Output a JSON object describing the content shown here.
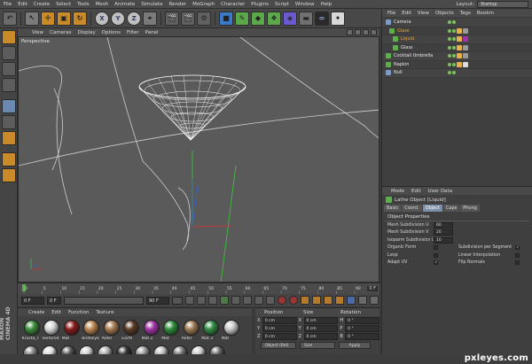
{
  "menubar": {
    "items": [
      "File",
      "Edit",
      "Create",
      "Select",
      "Tools",
      "Mesh",
      "Animate",
      "Simulate",
      "Render",
      "MoGraph",
      "Character",
      "Plugins",
      "Script",
      "Window",
      "Help"
    ],
    "layout_label": "Layout:",
    "layout_value": "Startup"
  },
  "viewport": {
    "menu": [
      "View",
      "Cameras",
      "Display",
      "Options",
      "Filter",
      "Panel"
    ],
    "label": "Perspective"
  },
  "timeline": {
    "ticks": [
      "0",
      "5",
      "10",
      "15",
      "20",
      "25",
      "30",
      "35",
      "40",
      "45",
      "50",
      "55",
      "60",
      "65",
      "70",
      "75",
      "80",
      "85",
      "90"
    ],
    "end_label": "0 F",
    "start_field": "0 F",
    "current_field": "0 F",
    "end_field": "90 F"
  },
  "materials": {
    "menu": [
      "Create",
      "Edit",
      "Function",
      "Texture"
    ],
    "items": [
      {
        "name": "Krusta_T",
        "color": "#3c8a3a"
      },
      {
        "name": "Textured",
        "color": "#d8d8d8"
      },
      {
        "name": "Mat",
        "color": "#8a1a1a"
      },
      {
        "name": "Birdseye",
        "color": "#b98550"
      },
      {
        "name": "Alder",
        "color": "#a57a4e"
      },
      {
        "name": "Earth",
        "color": "#5c3b26"
      },
      {
        "name": "Mat.2",
        "color": "#a034a7"
      },
      {
        "name": "Mat",
        "color": "#2e8a3a"
      },
      {
        "name": "Alder",
        "color": "#9b7a52"
      },
      {
        "name": "Mat.3",
        "color": "#2f8a42"
      },
      {
        "name": "Mat",
        "color": "#c8c8c8"
      }
    ],
    "brand": "MAXON CINEMA 4D"
  },
  "coordinates": {
    "headers": [
      "Position",
      "Size",
      "Rotation"
    ],
    "rows": [
      {
        "axis": "X",
        "pos": "0 cm",
        "size_axis": "X",
        "size": "0 cm",
        "rot_axis": "H",
        "rot": "0 °"
      },
      {
        "axis": "Y",
        "pos": "0 cm",
        "size_axis": "Y",
        "size": "0 cm",
        "rot_axis": "P",
        "rot": "0 °"
      },
      {
        "axis": "Z",
        "pos": "0 cm",
        "size_axis": "Z",
        "size": "0 cm",
        "rot_axis": "B",
        "rot": "0 °"
      }
    ],
    "mode": "Object (Rel)",
    "size_mode": "Size",
    "apply": "Apply"
  },
  "object_manager": {
    "menu": [
      "File",
      "Edit",
      "View",
      "Objects",
      "Tags",
      "Bookm"
    ],
    "objects": [
      {
        "name": "Camera",
        "selected": false,
        "icon_color": "#7a9cc8"
      },
      {
        "name": "Glass",
        "selected": true,
        "icon_color": "#5bb04a"
      },
      {
        "name": "Liquid",
        "selected": true,
        "icon_color": "#5bb04a"
      },
      {
        "name": "Glass",
        "selected": false,
        "icon_color": "#5bb04a"
      },
      {
        "name": "Cocktail Umbrella",
        "selected": false,
        "icon_color": "#5bb04a"
      },
      {
        "name": "Napkin",
        "selected": false,
        "icon_color": "#5bb04a"
      },
      {
        "name": "Null",
        "selected": false,
        "icon_color": "#7a9cc8"
      }
    ]
  },
  "attribute_manager": {
    "menu": [
      "Mode",
      "Edit",
      "User Data"
    ],
    "title": "Lathe Object [Liquid]",
    "tabs": [
      "Basic",
      "Coord.",
      "Object",
      "Caps",
      "Phong"
    ],
    "active_tab": "Object",
    "section": "Object Properties",
    "fields": [
      {
        "label": "Mesh Subdivision U",
        "value": "60"
      },
      {
        "label": "Mesh Subdivision V",
        "value": "20"
      },
      {
        "label": "Isoparm Subdivision U",
        "value": "10"
      }
    ],
    "checks_left": [
      {
        "label": "Organic Form",
        "checked": false
      },
      {
        "label": "Loop",
        "checked": false
      },
      {
        "label": "Adapt UV",
        "checked": true
      }
    ],
    "checks_right": [
      {
        "label": "Subdivision per Segment",
        "checked": true
      },
      {
        "label": "Linear Interpolation",
        "checked": false
      },
      {
        "label": "Flip Normals",
        "checked": false
      }
    ]
  },
  "watermark": "pxleyes.com",
  "colors": {
    "accent": "#e6a53a",
    "viewport_bg": "#5a5a5a",
    "wire": "#ffffff",
    "axis_green": "#3fbf3f",
    "axis_red": "#c23a3a",
    "axis_blue": "#3a5fd0"
  }
}
